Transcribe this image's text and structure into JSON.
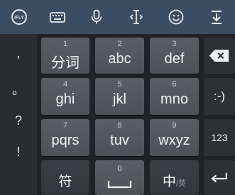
{
  "toolbar": {
    "logo_text": "iFLY",
    "icons": [
      "ifly-logo-icon",
      "keyboard-icon",
      "microphone-icon",
      "text-cursor-icon",
      "smiley-icon",
      "collapse-icon"
    ]
  },
  "punctuation": [
    ",",
    "。",
    "?",
    "!"
  ],
  "keys": {
    "row1": [
      {
        "num": "1",
        "label": "分词"
      },
      {
        "num": "2",
        "label": "abc"
      },
      {
        "num": "3",
        "label": "def"
      }
    ],
    "row2": [
      {
        "num": "4",
        "label": "ghi"
      },
      {
        "num": "5",
        "label": "jkl"
      },
      {
        "num": "6",
        "label": "mno"
      }
    ],
    "row3": [
      {
        "num": "7",
        "label": "pqrs"
      },
      {
        "num": "8",
        "label": "tuv"
      },
      {
        "num": "9",
        "label": "wxyz"
      }
    ],
    "row4": {
      "symbol": "符",
      "space_num": "0",
      "lang_main": "中",
      "lang_sub": "/英"
    }
  },
  "right": {
    "emoticon": ":-)",
    "numeric": "123"
  },
  "colors": {
    "toolbar": "#3b4d63",
    "background": "#202225",
    "key": "#55595e"
  }
}
